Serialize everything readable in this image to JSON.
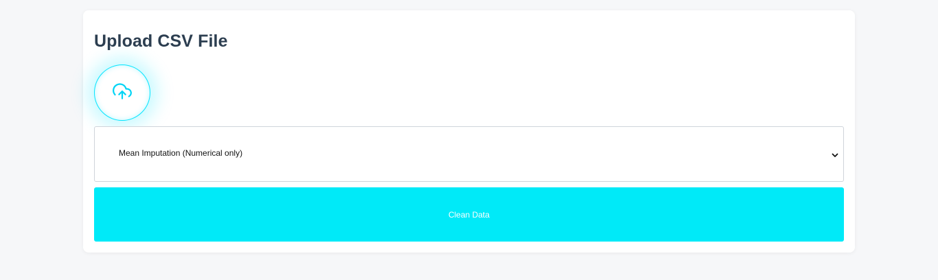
{
  "upload": {
    "title": "Upload CSV File",
    "icon": "cloud-upload-icon"
  },
  "imputation": {
    "selected": "Mean Imputation (Numerical only)",
    "icon": "chevron-down-icon"
  },
  "actions": {
    "clean_label": "Clean Data"
  },
  "colors": {
    "accent": "#00eaf8",
    "title": "#2c3e50",
    "background": "#f6f7f9"
  }
}
